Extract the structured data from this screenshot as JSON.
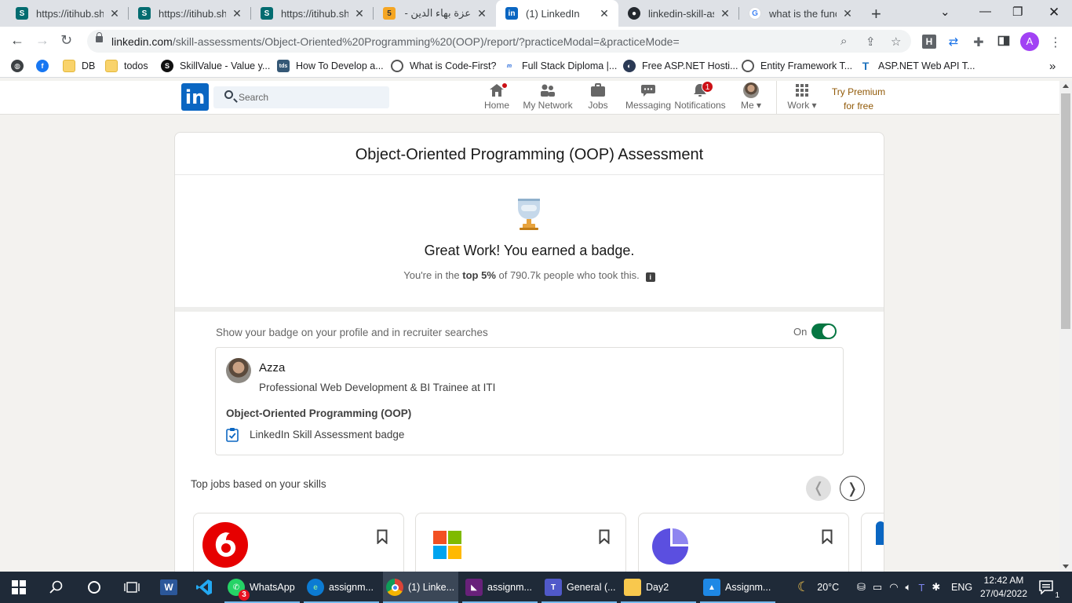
{
  "browser": {
    "tabs": [
      {
        "label": "https://itihub.sha",
        "favicon": "sharepoint-icon",
        "active": false
      },
      {
        "label": "https://itihub.sha",
        "favicon": "sharepoint-icon",
        "active": false
      },
      {
        "label": "https://itihub.sha",
        "favicon": "sharepoint-icon",
        "active": false
      },
      {
        "label": "عزة بهاء الدين - ج",
        "favicon": "5",
        "active": false
      },
      {
        "label": "(1) LinkedIn",
        "favicon": "linkedin-icon",
        "active": true
      },
      {
        "label": "linkedin-skill-asse",
        "favicon": "github-icon",
        "active": false
      },
      {
        "label": "what is the functi",
        "favicon": "google-icon",
        "active": false
      }
    ],
    "new_tab": "+",
    "url_host": "linkedin.com",
    "url_path": "/skill-assessments/Object-Oriented%20Programming%20(OOP)/report/?practiceModal=&practiceMode=",
    "profile_initial": "A",
    "extension_h": "H",
    "bookmarks": [
      {
        "label": "",
        "icon": "globe-icon"
      },
      {
        "label": "",
        "icon": "facebook-icon"
      },
      {
        "label": "DB",
        "icon": "folder-icon"
      },
      {
        "label": "todos",
        "icon": "folder-icon"
      },
      {
        "label": "SkillValue - Value y...",
        "icon": "skillvalue-icon"
      },
      {
        "label": "How To Develop a...",
        "icon": "tds-icon"
      },
      {
        "label": "What is Code-First?",
        "icon": "codefirst-icon"
      },
      {
        "label": "Full Stack Diploma |...",
        "icon": "diploma-icon"
      },
      {
        "label": "Free ASP.NET Hosti...",
        "icon": "hosting-icon"
      },
      {
        "label": "Entity Framework T...",
        "icon": "ef-icon"
      },
      {
        "label": "ASP.NET Web API T...",
        "icon": "webapi-icon"
      }
    ],
    "bookmarks_more": "»"
  },
  "linkedin": {
    "logo": "in",
    "search_placeholder": "Search",
    "nav": {
      "home": "Home",
      "network": "My Network",
      "jobs": "Jobs",
      "messaging": "Messaging",
      "notifications": "Notifications",
      "notifications_count": "1",
      "me": "Me",
      "work": "Work"
    },
    "premium_line1": "Try Premium",
    "premium_line2": "for free"
  },
  "assessment": {
    "title": "Object-Oriented Programming (OOP) Assessment",
    "headline": "Great Work! You earned a badge.",
    "rank_prefix": "You're in the ",
    "rank_bold": "top 5%",
    "rank_suffix": " of 790.7k people who took this.",
    "info_icon": "i",
    "show_badge_text": "Show your badge on your profile and in recruiter searches",
    "toggle_label": "On",
    "toggle_on": true,
    "profile": {
      "name": "Azza",
      "headline": "Professional Web Development & BI Trainee at ITI",
      "skill": "Object-Oriented Programming (OOP)",
      "badge_text": "LinkedIn Skill Assessment badge"
    },
    "top_jobs_title": "Top jobs based on your skills",
    "prev_label": "❬",
    "next_label": "❭",
    "job_cards": [
      {
        "company_icon": "vodafone-logo"
      },
      {
        "company_icon": "microsoft-logo"
      },
      {
        "company_icon": "purple-company-logo"
      }
    ]
  },
  "taskbar": {
    "apps": [
      {
        "label": "WhatsApp",
        "icon": "whatsapp-icon",
        "badge": "3"
      },
      {
        "label": "assignm...",
        "icon": "edge-icon"
      },
      {
        "label": "(1) Linke...",
        "icon": "chrome-icon",
        "active": true
      },
      {
        "label": "assignm...",
        "icon": "visual-studio-icon"
      },
      {
        "label": "General (...",
        "icon": "teams-icon"
      },
      {
        "label": "Day2",
        "icon": "file-explorer-icon"
      },
      {
        "label": "Assignm...",
        "icon": "photos-icon"
      }
    ],
    "weather": "20°C",
    "language": "ENG",
    "time": "12:42 AM",
    "date": "27/04/2022",
    "notification_count": "1"
  }
}
